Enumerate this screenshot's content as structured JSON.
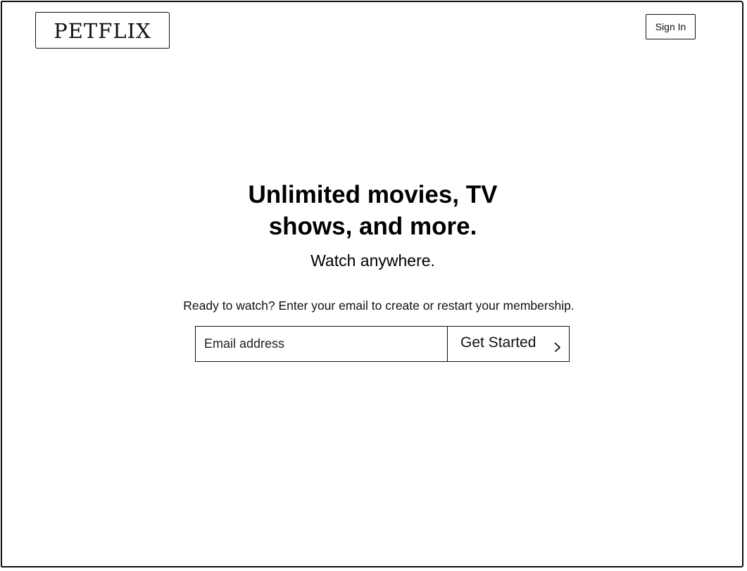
{
  "header": {
    "logo_text": "PETFLIX",
    "signin_label": "Sign In"
  },
  "hero": {
    "title_line1": "Unlimited movies, TV",
    "title_line2": "shows, and more.",
    "subtitle": "Watch anywhere."
  },
  "signup": {
    "prompt": "Ready to watch? Enter your email to create or restart your membership.",
    "email_placeholder": "Email address",
    "email_value": "",
    "cta_label": "Get Started",
    "cta_icon": "chevron-right-icon"
  },
  "colors": {
    "ink": "#111111",
    "background": "#ffffff"
  }
}
